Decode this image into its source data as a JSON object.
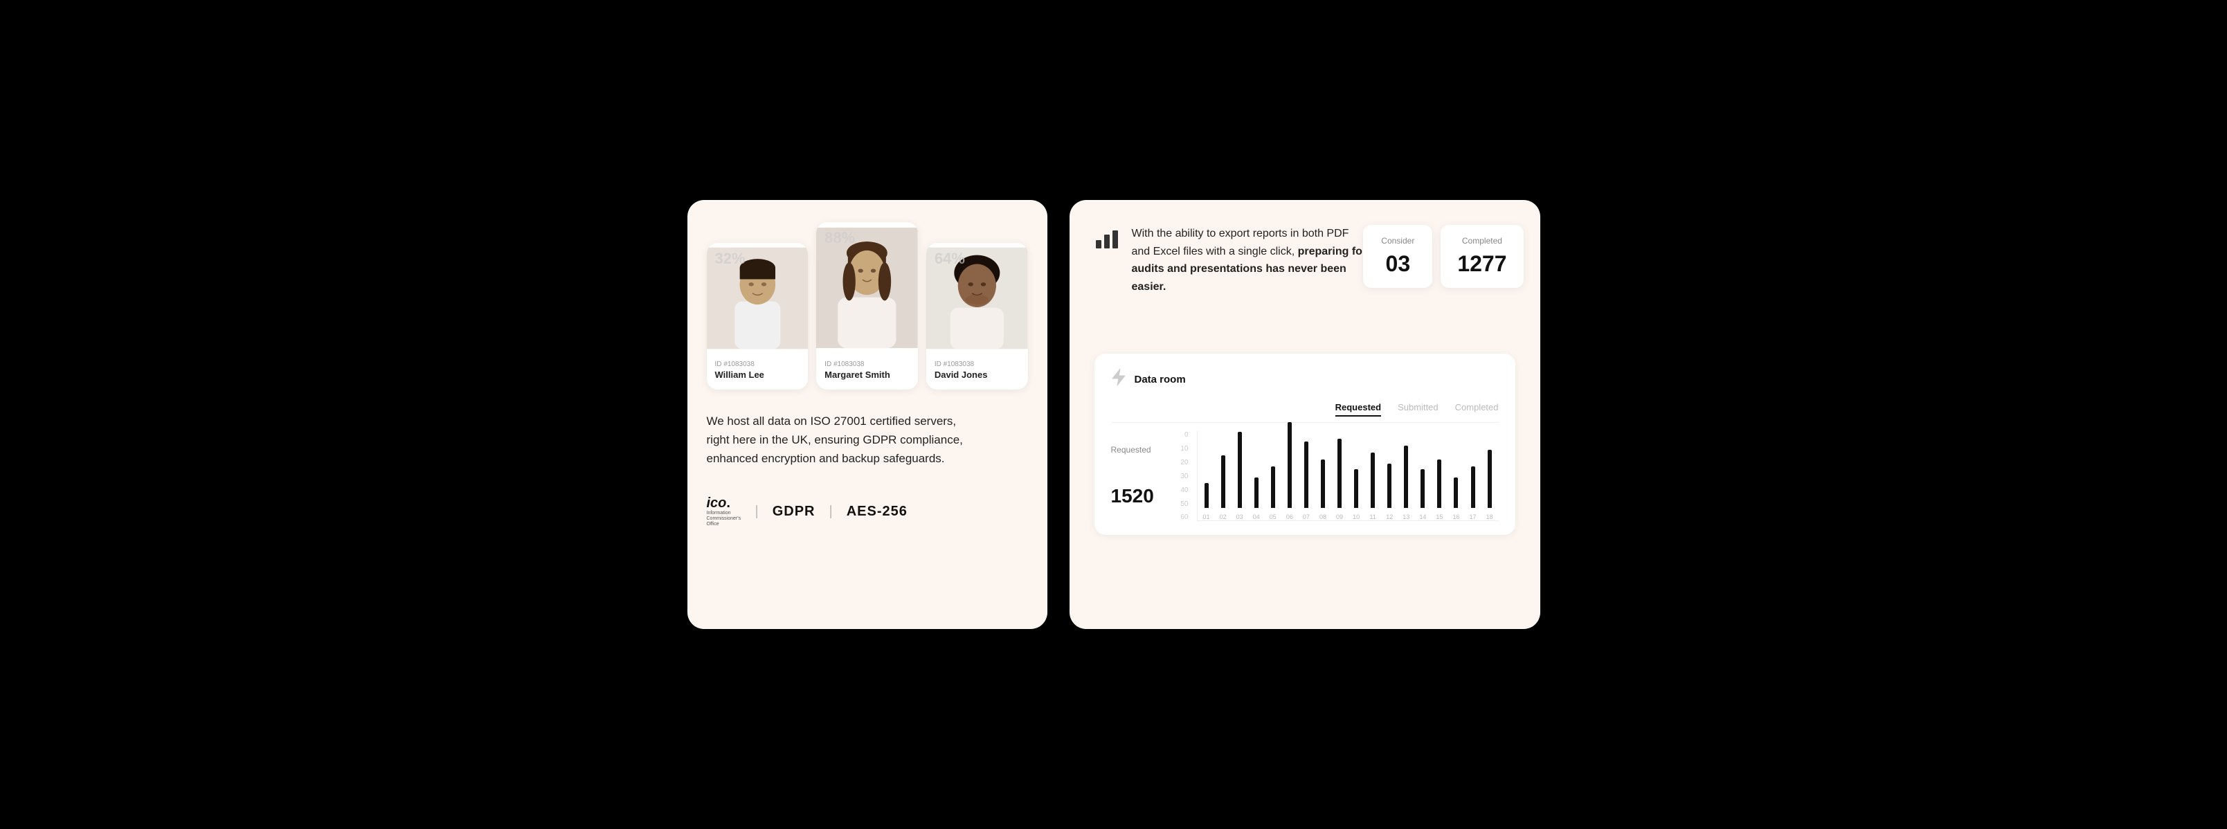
{
  "left": {
    "profiles": [
      {
        "percent": "32%",
        "id": "ID #1083038",
        "name": "William Lee",
        "skin": "#c4a882"
      },
      {
        "percent": "88%",
        "id": "ID #1083038",
        "name": "Margaret Smith",
        "skin": "#c4a882"
      },
      {
        "percent": "64%",
        "id": "ID #1083038",
        "name": "David Jones",
        "skin": "#8b6347"
      }
    ],
    "security_text_1": "We host all data on ISO 27001 certified servers, right here in the UK, ensuring GDPR compliance, enhanced encryption and  backup safeguards.",
    "badge_ico": "ico.",
    "badge_ico_sub": "Information Commissioner's Office",
    "badge_gdpr": "GDPR",
    "badge_aes": "AES-256"
  },
  "right": {
    "export_text_plain": "With the ability to export reports in both PDF and Excel files with a single click,",
    "export_text_bold": " preparing for audits and presentations has never been easier.",
    "stat_consider_label": "Consider",
    "stat_consider_value": "03",
    "stat_completed_label": "Completed",
    "stat_completed_value": "1277",
    "data_room_title": "Data room",
    "tabs": [
      "Requested",
      "Submitted",
      "Completed"
    ],
    "active_tab": "Requested",
    "chart_row_label": "Requested",
    "chart_row_value": "1520",
    "y_axis": [
      "60",
      "50",
      "40",
      "30",
      "20",
      "10",
      "0"
    ],
    "x_labels": [
      "01",
      "02",
      "03",
      "04",
      "05",
      "06",
      "07",
      "08",
      "09",
      "10",
      "11",
      "12",
      "13",
      "14",
      "15",
      "16",
      "17",
      "18"
    ],
    "bars": [
      18,
      38,
      55,
      22,
      30,
      62,
      48,
      35,
      50,
      28,
      40,
      32,
      45,
      28,
      35,
      22,
      30,
      42
    ]
  }
}
